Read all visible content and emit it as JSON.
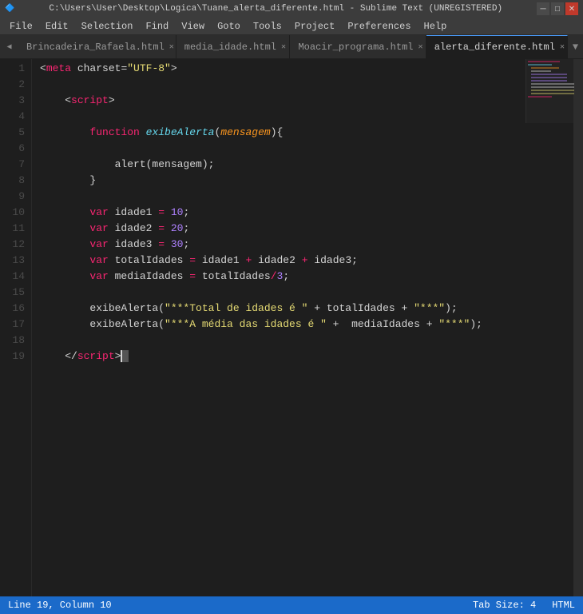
{
  "titlebar": {
    "text": "C:\\Users\\User\\Desktop\\Logica\\Tuane_alerta_diferente.html - Sublime Text (UNREGISTERED)"
  },
  "menubar": {
    "items": [
      "File",
      "Edit",
      "Selection",
      "Find",
      "View",
      "Goto",
      "Tools",
      "Project",
      "Preferences",
      "Help"
    ]
  },
  "tabs": [
    {
      "label": "Brincadeira_Rafaela.html",
      "active": false
    },
    {
      "label": "media_idade.html",
      "active": false
    },
    {
      "label": "Moacir_programa.html",
      "active": false
    },
    {
      "label": "alerta_diferente.html",
      "active": true
    }
  ],
  "statusbar": {
    "position": "Line 19, Column 10",
    "tabsize": "Tab Size: 4",
    "syntax": "HTML"
  }
}
